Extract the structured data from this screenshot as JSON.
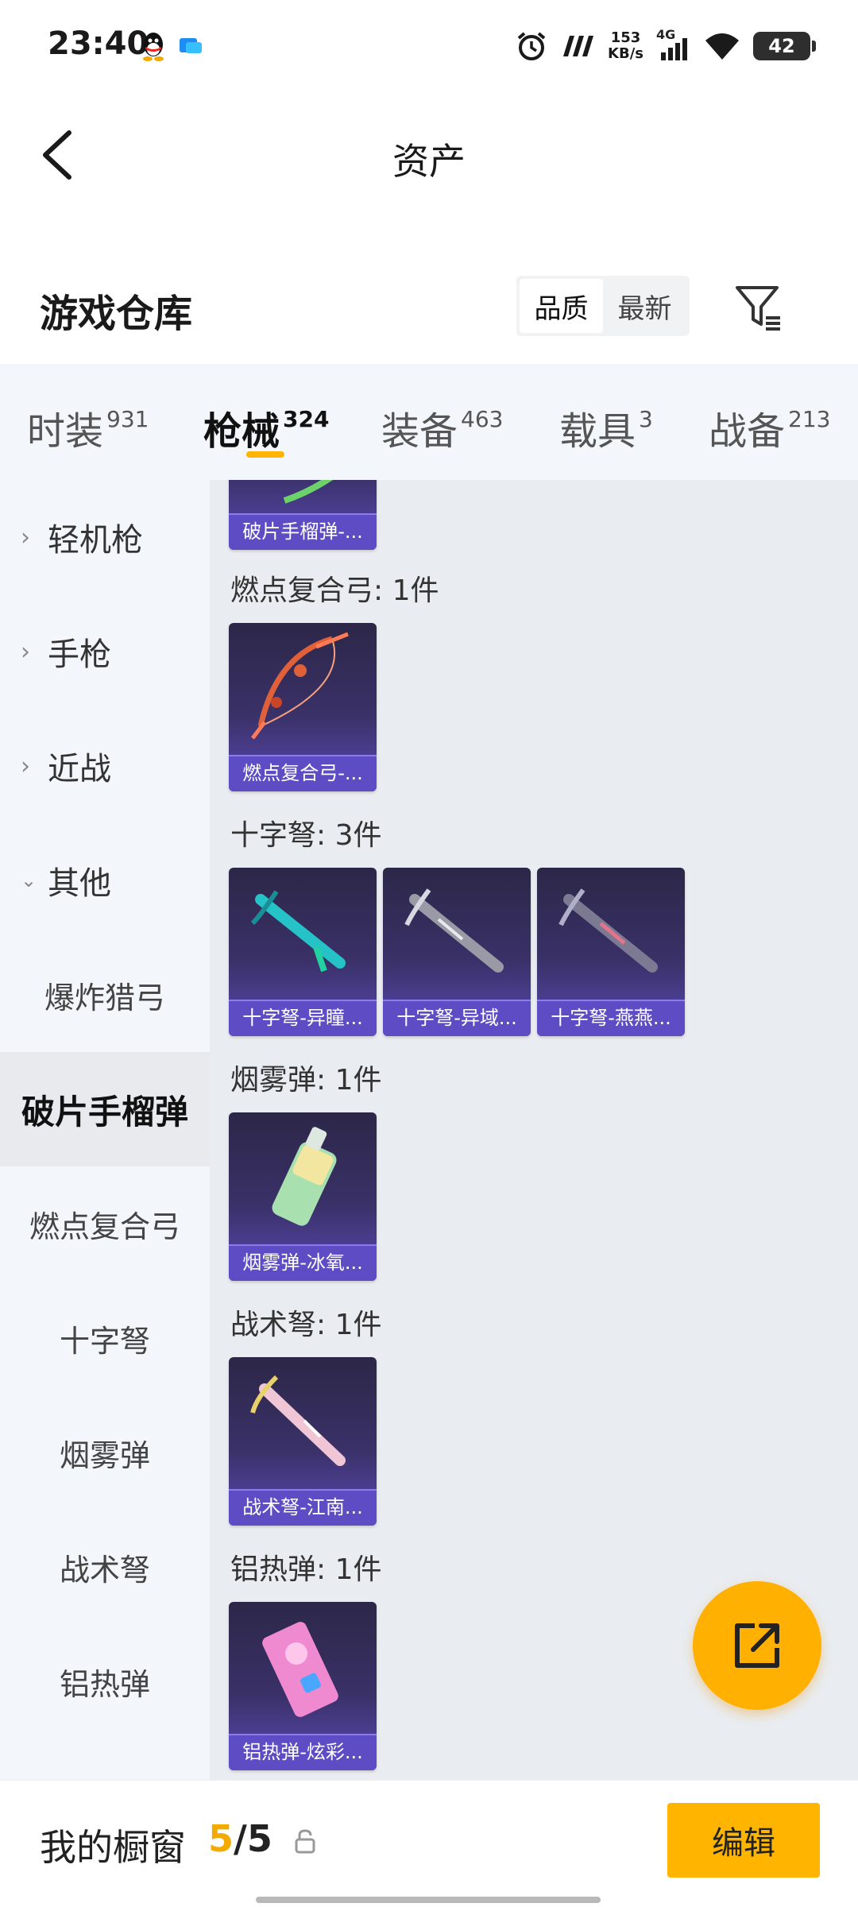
{
  "status_bar": {
    "time": "23:40",
    "net_speed_value": "153",
    "net_speed_unit": "KB/s",
    "network_type": "4G",
    "battery": "42",
    "icons": [
      "qq-icon",
      "app-icon",
      "alarm-icon",
      "nfc-icon",
      "signal-icon",
      "wifi-icon",
      "battery-icon"
    ]
  },
  "header": {
    "title": "资产"
  },
  "section": {
    "title": "游戏仓库",
    "sort_options": [
      "品质",
      "最新"
    ],
    "sort_selected": "品质"
  },
  "tabs": [
    {
      "label": "时装",
      "count": "931"
    },
    {
      "label": "枪械",
      "count": "324",
      "active": true
    },
    {
      "label": "装备",
      "count": "463"
    },
    {
      "label": "载具",
      "count": "3"
    },
    {
      "label": "战备",
      "count": "213"
    }
  ],
  "sidebar": {
    "items": [
      {
        "label": "轻机枪",
        "expandable": true
      },
      {
        "label": "手枪",
        "expandable": true
      },
      {
        "label": "近战",
        "expandable": true
      },
      {
        "label": "其他",
        "expandable": true,
        "expanded": true
      },
      {
        "label": "爆炸猎弓"
      },
      {
        "label": "破片手榴弹",
        "selected": true
      },
      {
        "label": "燃点复合弓"
      },
      {
        "label": "十字弩"
      },
      {
        "label": "烟雾弹"
      },
      {
        "label": "战术弩"
      },
      {
        "label": "铝热弹"
      }
    ]
  },
  "content": {
    "groups": [
      {
        "label": "",
        "items": [
          {
            "name": "破片手榴弹-..."
          }
        ]
      },
      {
        "label": "燃点复合弓: 1件",
        "items": [
          {
            "name": "燃点复合弓-..."
          }
        ]
      },
      {
        "label": "十字弩: 3件",
        "items": [
          {
            "name": "十字弩-异瞳..."
          },
          {
            "name": "十字弩-异域..."
          },
          {
            "name": "十字弩-燕燕..."
          }
        ]
      },
      {
        "label": "烟雾弹: 1件",
        "items": [
          {
            "name": "烟雾弹-冰氧..."
          }
        ]
      },
      {
        "label": "战术弩: 1件",
        "items": [
          {
            "name": "战术弩-江南..."
          }
        ]
      },
      {
        "label": "铝热弹: 1件",
        "items": [
          {
            "name": "铝热弹-炫彩..."
          }
        ]
      }
    ]
  },
  "fab": {
    "icon": "share-external-icon"
  },
  "bottom_bar": {
    "label": "我的橱窗",
    "count_current": "5",
    "count_total": "5",
    "edit_label": "编辑"
  },
  "colors": {
    "accent": "#ffb400",
    "card_label_bg": "#5d4cc4",
    "card_bg_top": "#2c2748"
  }
}
